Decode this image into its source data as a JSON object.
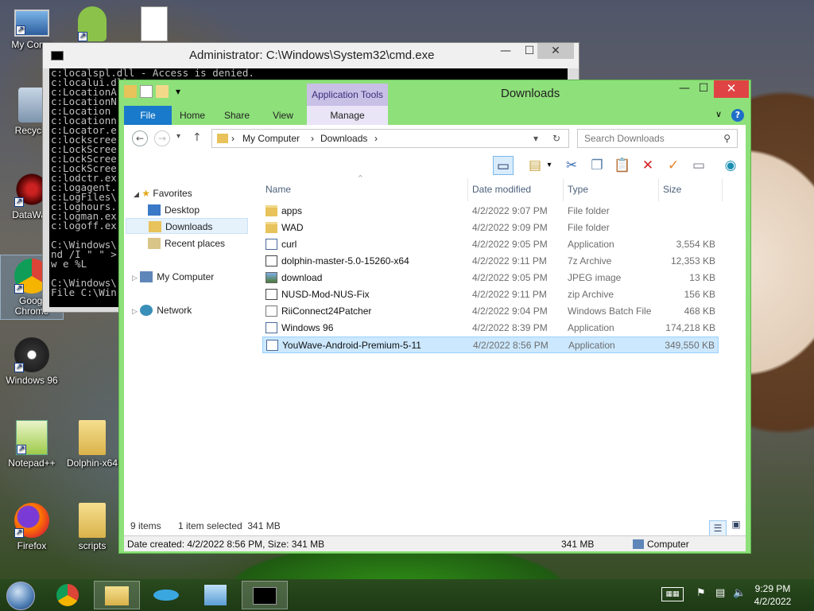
{
  "desktop_icons": [
    {
      "label": "My Comp",
      "icon": "computer-icon"
    },
    {
      "label": "",
      "icon": "android-icon"
    },
    {
      "label": "",
      "icon": "document-icon"
    },
    {
      "label": "Recycle",
      "icon": "recycle-bin-icon"
    },
    {
      "label": "DataWag",
      "icon": "datawag-icon"
    },
    {
      "label": "Googl Chrome",
      "icon": "chrome-icon"
    },
    {
      "label": "Windows 96",
      "icon": "windows96-icon"
    },
    {
      "label": "Notepad++",
      "icon": "notepad-icon"
    },
    {
      "label": "Dolphin-x64",
      "icon": "folder-icon"
    },
    {
      "label": "Firefox",
      "icon": "firefox-icon"
    },
    {
      "label": "scripts",
      "icon": "folder-icon"
    }
  ],
  "cmd": {
    "title": "Administrator: C:\\Windows\\System32\\cmd.exe",
    "lines": [
      "c:localspl.dll - Access is denied.",
      "c:localui.dll",
      "c:LocationA",
      "c:LocationN",
      "c:Location",
      "c:locationn",
      "c:Locator.e",
      "c:lockscree",
      "c:LockScree",
      "c:LockScree",
      "c:LockScree",
      "c:lodctr.ex",
      "c:logagent.",
      "c:LogFiles\\",
      "c:loghours.",
      "c:logman.ex",
      "c:logoff.ex",
      "",
      "C:\\Windows\\",
      "nd /I \" \" >",
      "w e %L",
      "",
      "C:\\Windows\\",
      "File C:\\Win",
      "",
      "C:\\Windows\\"
    ],
    "min": "—",
    "max": "☐",
    "close": "✕"
  },
  "explorer": {
    "title": "Downloads",
    "app_tools": "Application Tools",
    "tabs": {
      "file": "File",
      "home": "Home",
      "share": "Share",
      "view": "View",
      "manage": "Manage"
    },
    "address": {
      "root": "My Computer",
      "current": "Downloads"
    },
    "search_placeholder": "Search Downloads",
    "nav": {
      "favorites": "Favorites",
      "desktop": "Desktop",
      "downloads": "Downloads",
      "recent": "Recent places",
      "my_computer": "My Computer",
      "network": "Network"
    },
    "columns": {
      "name": "Name",
      "date": "Date modified",
      "type": "Type",
      "size": "Size"
    },
    "files": [
      {
        "name": "apps",
        "date": "4/2/2022 9:07 PM",
        "type": "File folder",
        "size": "",
        "icon": "folder"
      },
      {
        "name": "WAD",
        "date": "4/2/2022 9:09 PM",
        "type": "File folder",
        "size": "",
        "icon": "folder"
      },
      {
        "name": "curl",
        "date": "4/2/2022 9:05 PM",
        "type": "Application",
        "size": "3,554 KB",
        "icon": "app"
      },
      {
        "name": "dolphin-master-5.0-15260-x64",
        "date": "4/2/2022 9:11 PM",
        "type": "7z Archive",
        "size": "12,353 KB",
        "icon": "zip7"
      },
      {
        "name": "download",
        "date": "4/2/2022 9:05 PM",
        "type": "JPEG image",
        "size": "13 KB",
        "icon": "img-i"
      },
      {
        "name": "NUSD-Mod-NUS-Fix",
        "date": "4/2/2022 9:11 PM",
        "type": "zip Archive",
        "size": "156 KB",
        "icon": "zip7"
      },
      {
        "name": "RiiConnect24Patcher",
        "date": "4/2/2022 9:04 PM",
        "type": "Windows Batch File",
        "size": "468 KB",
        "icon": "bat"
      },
      {
        "name": "Windows 96",
        "date": "4/2/2022 8:39 PM",
        "type": "Application",
        "size": "174,218 KB",
        "icon": "app"
      },
      {
        "name": "YouWave-Android-Premium-5-11",
        "date": "4/2/2022 8:56 PM",
        "type": "Application",
        "size": "349,550 KB",
        "icon": "app"
      }
    ],
    "status": {
      "count": "9 items",
      "selected": "1 item selected  341 MB"
    },
    "details": {
      "left": "Date created: 4/2/2022 8:56 PM, Size: 341 MB",
      "size": "341 MB",
      "location": "Computer"
    }
  },
  "taskbar": {
    "time": "9:29 PM",
    "date": "4/2/2022"
  }
}
